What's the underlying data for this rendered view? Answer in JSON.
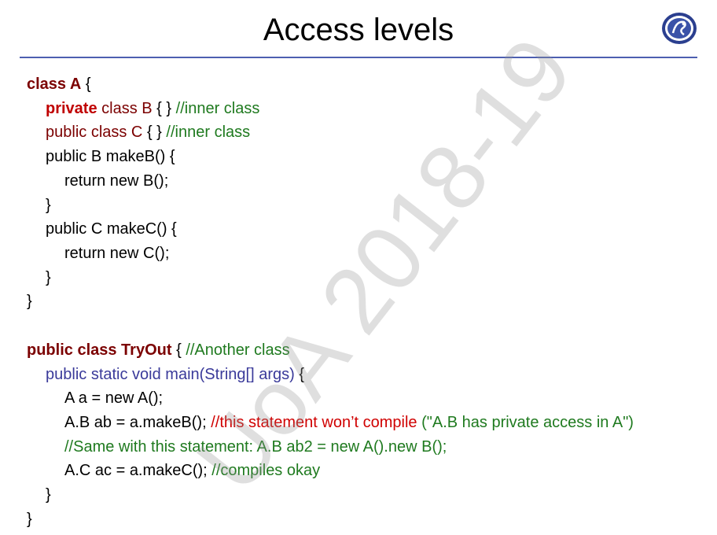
{
  "title": "Access levels",
  "watermark": "UoA 2018-19",
  "footer": "",
  "colors": {
    "rule": "#4d5fb0",
    "keyword": "#7b0000",
    "red": "#d00000",
    "green": "#1f7a1f",
    "blue": "#3a3a9a"
  },
  "logo_icon": "university-seal",
  "code": {
    "l1": {
      "kw": "class A",
      "rest": " {"
    },
    "l2": {
      "kw": "private",
      "cls": " class B",
      "rest": " { } ",
      "cmt": "//inner class"
    },
    "l3": {
      "cls": "public class C",
      "rest": " { } ",
      "cmt": "//inner class"
    },
    "l4": "public B makeB() {",
    "l5": "return new B();",
    "l6": "}",
    "l7": "public C makeC() {",
    "l8": "return new C();",
    "l9": "}",
    "l10": "}",
    "l11": {
      "kw": "public class TryOut",
      "rest": " { ",
      "cmt": "//Another class"
    },
    "l12": {
      "sig": "public static void main(String[] args)",
      "rest": " {"
    },
    "l13": "A a = new A();",
    "l14": {
      "code": "A.B ab = a.makeB(); ",
      "cmt": "//this statement won’t compile",
      "msg": " (\"A.B has private access in A\")"
    },
    "l15": "//Same with this statement: A.B ab2 = new A().new B();",
    "l16": {
      "code": "A.C ac = a.makeC(); ",
      "cmt": "//compiles okay"
    },
    "l17": "}",
    "l18": "}"
  }
}
